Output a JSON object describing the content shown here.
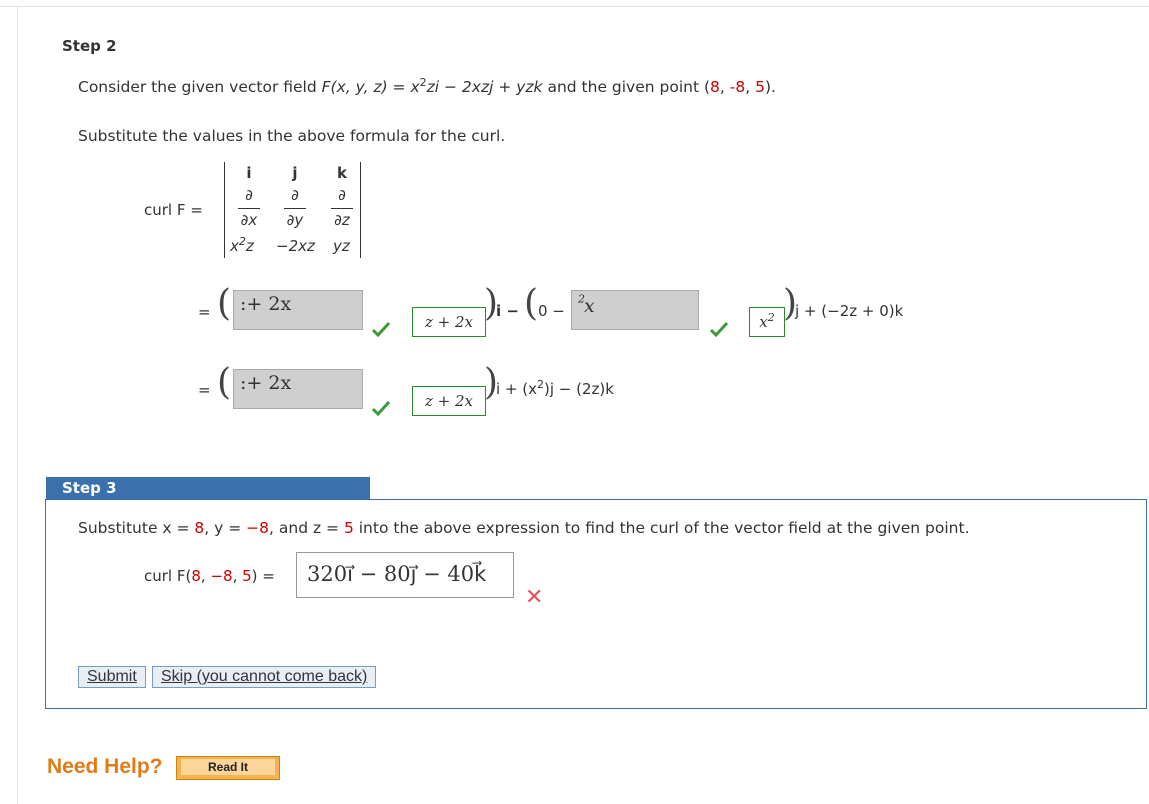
{
  "step2": {
    "heading": "Step 2",
    "intro": {
      "prefix": "Consider the given vector field ",
      "field": "F(x, y, z) = x",
      "sup": "2",
      "rest": "zi − 2xzj + yzk",
      "mid": " and the given point (",
      "p1": "8",
      "sep1": ", ",
      "p2": "-8",
      "sep2": ", ",
      "p3": "5",
      "end": ")."
    },
    "substitute": "Substitute the values in the above formula for the curl.",
    "curl_label": "curl F =",
    "det": {
      "row1": [
        "i",
        "j",
        "k"
      ],
      "partial": "∂",
      "denoms": [
        "∂x",
        "∂y",
        "∂z"
      ],
      "row3_a": "x",
      "row3_a_sup": "2",
      "row3_a_rest": "z",
      "row3_b": "−2xz",
      "row3_c": "yz"
    },
    "eq": "=",
    "line1": {
      "box1": ":+ 2x",
      "box2": "z + 2x",
      "i_minus": "i −",
      "zero_minus": "0 −",
      "box3": "x",
      "box3_sup": "2",
      "box4": "x",
      "box4_sup": "2",
      "tail": "j + (−2z + 0)k"
    },
    "line2": {
      "box1": ":+ 2x",
      "box2": "z + 2x",
      "tail_a": "i + (x",
      "tail_sup": "2",
      "tail_b": ")j − (2z)k"
    }
  },
  "step3": {
    "heading": "Step 3",
    "instruction": {
      "a": "Substitute x = ",
      "x": "8",
      "b": ", y = ",
      "y": "−8",
      "c": ", and z = ",
      "z": "5",
      "d": " into the above expression to find the curl of the vector field at the given point."
    },
    "curl_at": {
      "a": "curl F(",
      "x": "8",
      "s1": ", ",
      "y": "−8",
      "s2": ", ",
      "z": "5",
      "b": ") ="
    },
    "answer": "320i⃗ − 80j⃗ − 40k⃗",
    "wrong_mark": "✕",
    "submit_label": "Submit",
    "skip_label": "Skip (you cannot come back)"
  },
  "help": {
    "label": "Need Help?",
    "read_it": "Read It"
  },
  "colors": {
    "accent": "#3a70ad",
    "correct": "#3c9a3c",
    "wrong": "#e05555",
    "highlight": "#cc0000",
    "help": "#e07b17"
  }
}
